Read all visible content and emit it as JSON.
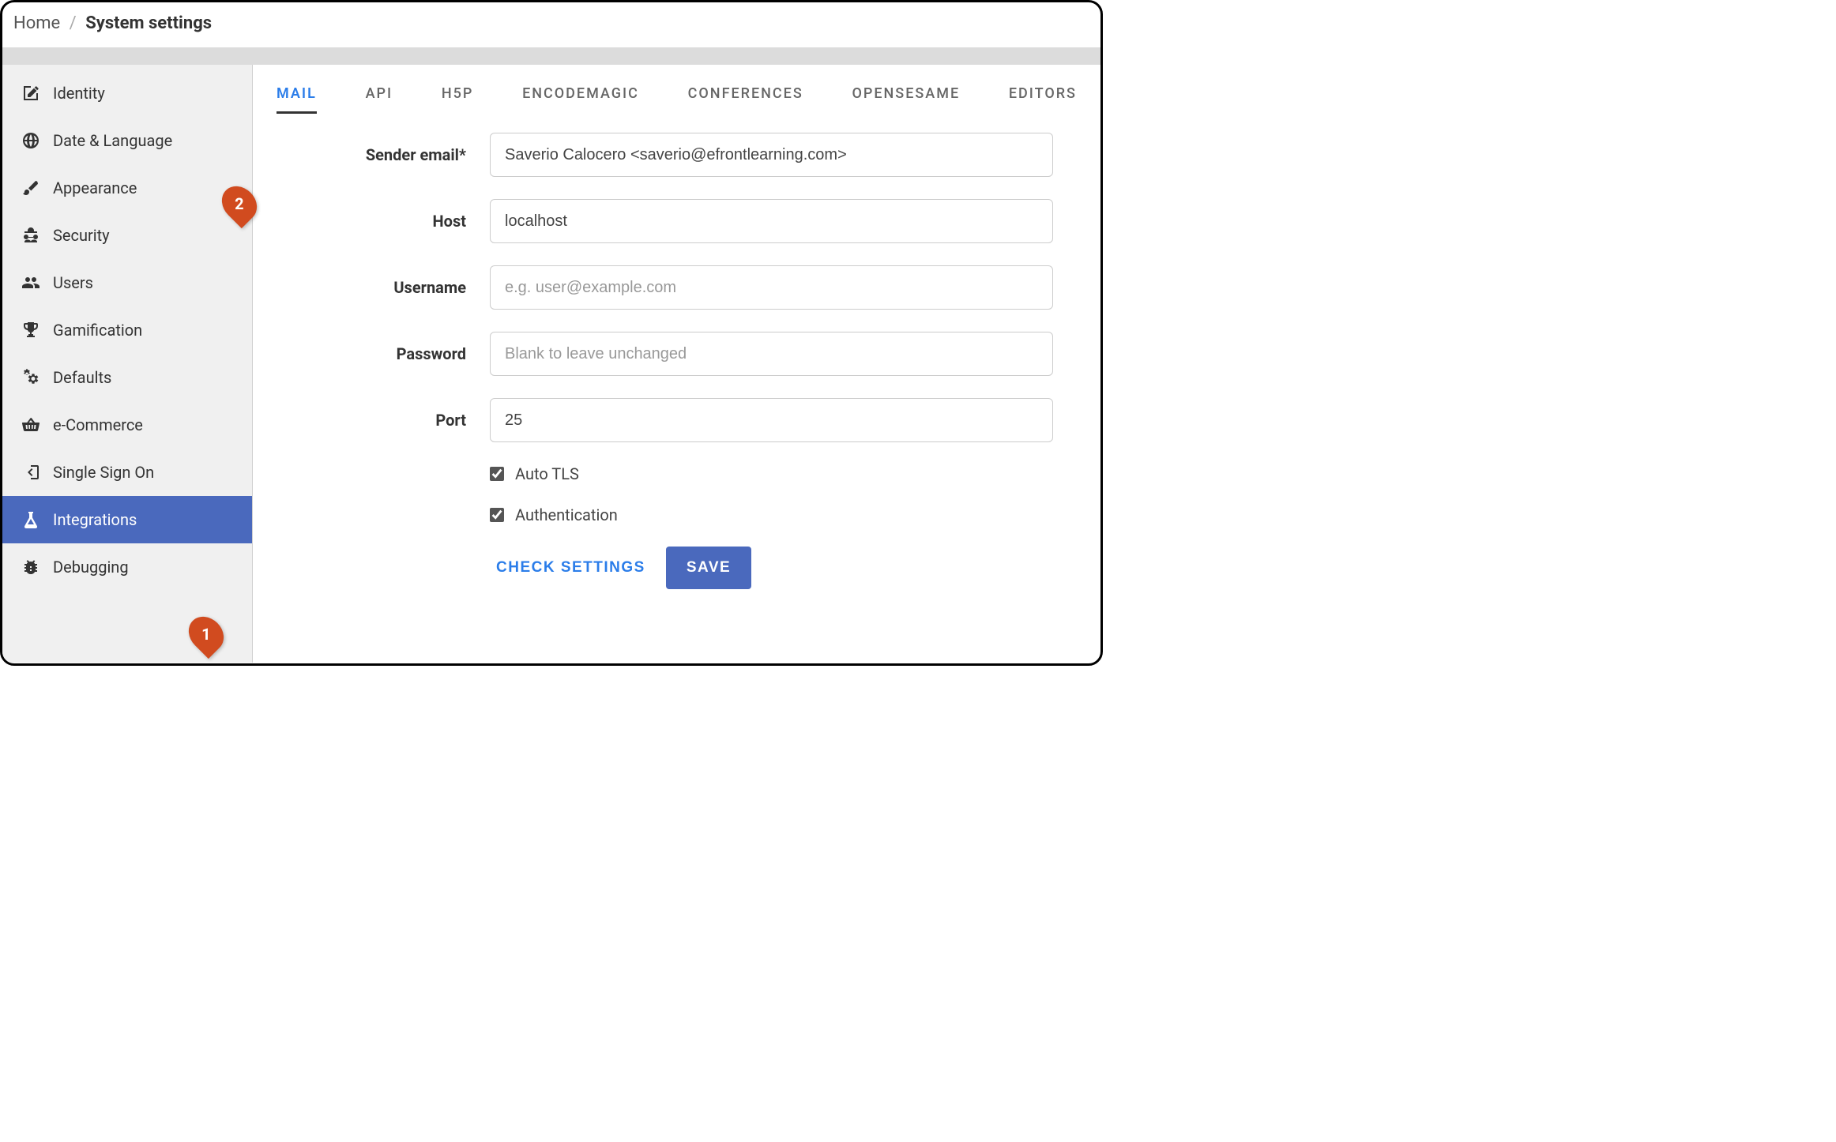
{
  "breadcrumb": {
    "home": "Home",
    "current": "System settings"
  },
  "sidebar": {
    "items": [
      {
        "label": "Identity",
        "icon": "pencil-square"
      },
      {
        "label": "Date & Language",
        "icon": "globe"
      },
      {
        "label": "Appearance",
        "icon": "brush"
      },
      {
        "label": "Security",
        "icon": "spy"
      },
      {
        "label": "Users",
        "icon": "users"
      },
      {
        "label": "Gamification",
        "icon": "trophy"
      },
      {
        "label": "Defaults",
        "icon": "gears"
      },
      {
        "label": "e-Commerce",
        "icon": "basket"
      },
      {
        "label": "Single Sign On",
        "icon": "signin"
      },
      {
        "label": "Integrations",
        "icon": "flask",
        "active": true
      },
      {
        "label": "Debugging",
        "icon": "bug"
      }
    ]
  },
  "tabs": [
    {
      "label": "MAIL",
      "active": true
    },
    {
      "label": "API"
    },
    {
      "label": "H5P"
    },
    {
      "label": "ENCODEMAGIC"
    },
    {
      "label": "CONFERENCES"
    },
    {
      "label": "OPENSESAME"
    },
    {
      "label": "EDITORS"
    }
  ],
  "form": {
    "sender_label": "Sender email*",
    "sender_value": "Saverio Calocero <saverio@efrontlearning.com>",
    "host_label": "Host",
    "host_value": "localhost",
    "username_label": "Username",
    "username_value": "",
    "username_placeholder": "e.g. user@example.com",
    "password_label": "Password",
    "password_value": "",
    "password_placeholder": "Blank to leave unchanged",
    "port_label": "Port",
    "port_value": "25",
    "auto_tls_label": "Auto TLS",
    "auto_tls_checked": true,
    "authentication_label": "Authentication",
    "authentication_checked": true
  },
  "buttons": {
    "check": "CHECK SETTINGS",
    "save": "SAVE"
  },
  "callouts": {
    "one": "1",
    "two": "2"
  }
}
